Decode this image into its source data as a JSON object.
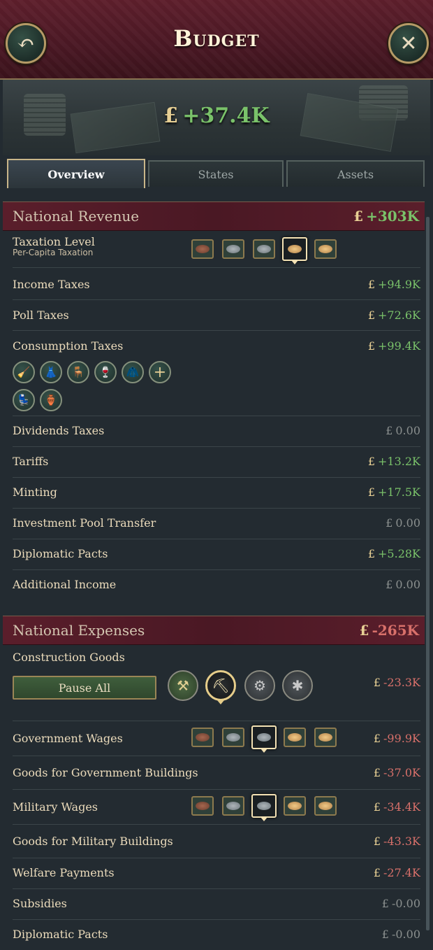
{
  "window": {
    "title": "Budget",
    "back_icon": "back-arrow-icon",
    "close_icon": "close-icon"
  },
  "balance": {
    "currency": "£",
    "value": "+37.4K"
  },
  "tabs": [
    {
      "label": "Overview",
      "active": true
    },
    {
      "label": "States",
      "active": false
    },
    {
      "label": "Assets",
      "active": false
    }
  ],
  "revenue": {
    "title": "National Revenue",
    "currency": "£",
    "total": "+303K",
    "taxation": {
      "label": "Taxation Level",
      "sublabel": "Per-Capita Taxation",
      "levels": 5,
      "selected_level": 4
    },
    "rows": [
      {
        "label": "Income Taxes",
        "value": "+94.9K"
      },
      {
        "label": "Poll Taxes",
        "value": "+72.6K"
      },
      {
        "label": "Consumption Taxes",
        "value": "+99.4K"
      },
      {
        "label": "Dividends Taxes",
        "value": "0.00"
      },
      {
        "label": "Tariffs",
        "value": "+13.2K"
      },
      {
        "label": "Minting",
        "value": "+17.5K"
      },
      {
        "label": "Investment Pool Transfer",
        "value": "0.00"
      },
      {
        "label": "Diplomatic Pacts",
        "value": "+5.28K"
      },
      {
        "label": "Additional Income",
        "value": "0.00"
      }
    ],
    "consumption_goods": [
      "brush-goods-icon",
      "clothes-goods-icon",
      "furniture-goods-icon",
      "liquor-goods-icon",
      "luxury-clothes-icon",
      "add-tax-icon",
      "luxury-furniture-icon",
      "porcelain-goods-icon"
    ]
  },
  "expenses": {
    "title": "National Expenses",
    "currency": "£",
    "total": "-265K",
    "construction": {
      "label": "Construction Goods",
      "pause_label": "Pause All",
      "value": "-23.3K",
      "icons": [
        "wood-construction-icon",
        "iron-construction-icon",
        "steel-construction-icon",
        "arc-welded-construction-icon"
      ],
      "selected_icon": 1
    },
    "rows": [
      {
        "label": "Government Wages",
        "value": "-99.9K",
        "selected_level": 2
      },
      {
        "label": "Goods for Government Buildings",
        "value": "-37.0K"
      },
      {
        "label": "Military Wages",
        "value": "-34.4K",
        "selected_level": 2
      },
      {
        "label": "Goods for Military Buildings",
        "value": "-43.3K"
      },
      {
        "label": "Welfare Payments",
        "value": "-27.4K"
      },
      {
        "label": "Subsidies",
        "value": "-0.00"
      },
      {
        "label": "Diplomatic Pacts",
        "value": "-0.00"
      }
    ]
  }
}
